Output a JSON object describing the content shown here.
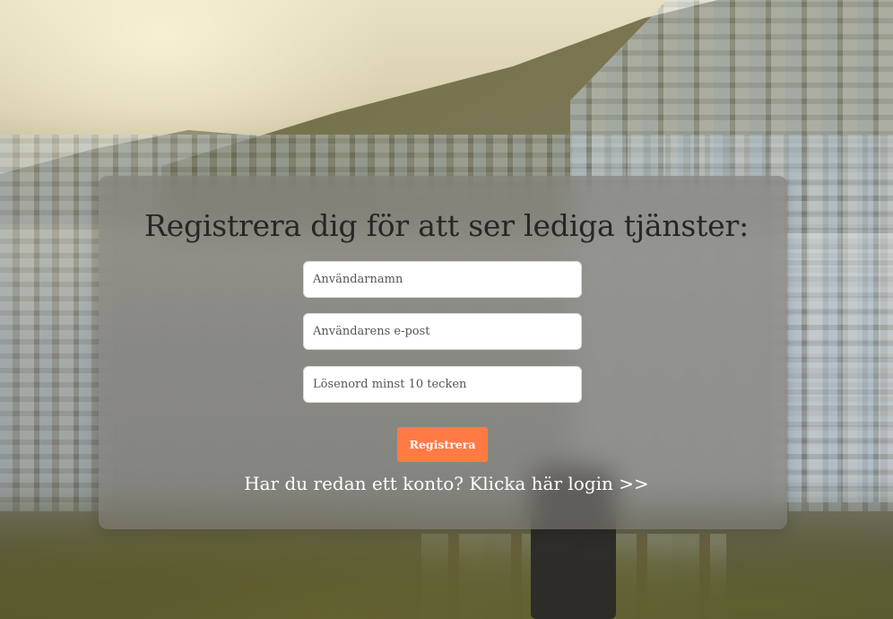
{
  "form": {
    "title": "Registrera dig för att ser lediga tjänster:",
    "username": {
      "placeholder": "Användarnamn",
      "value": ""
    },
    "email": {
      "placeholder": "Användarens e-post",
      "value": ""
    },
    "password": {
      "placeholder": "Lösenord minst 10 tecken",
      "value": ""
    },
    "submit_label": "Registrera",
    "login_link": "Har du redan ett konto? Klicka här login >>"
  },
  "colors": {
    "accent": "#ff7a45",
    "title": "#262626",
    "link": "#ffffff",
    "card": "rgba(128,124,118,0.62)"
  }
}
